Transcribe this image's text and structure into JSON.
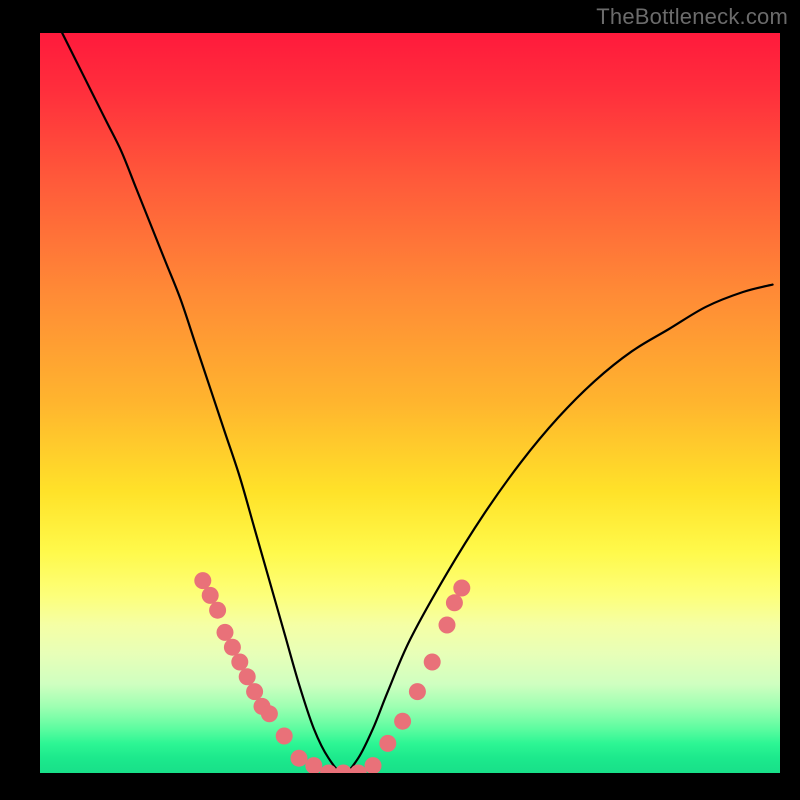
{
  "watermark": "TheBottleneck.com",
  "chart_data": {
    "type": "line",
    "title": "",
    "xlabel": "",
    "ylabel": "",
    "xlim": [
      0,
      100
    ],
    "ylim": [
      0,
      100
    ],
    "grid": false,
    "legend": false,
    "series": [
      {
        "name": "bottleneck-curve",
        "color": "#000000",
        "x": [
          3,
          5,
          7,
          9,
          11,
          13,
          15,
          17,
          19,
          21,
          23,
          25,
          27,
          29,
          31,
          33,
          35,
          37,
          39,
          41,
          43,
          45,
          47,
          50,
          55,
          60,
          65,
          70,
          75,
          80,
          85,
          90,
          95,
          99
        ],
        "values": [
          100,
          96,
          92,
          88,
          84,
          79,
          74,
          69,
          64,
          58,
          52,
          46,
          40,
          33,
          26,
          19,
          12,
          6,
          2,
          0,
          2,
          6,
          11,
          18,
          27,
          35,
          42,
          48,
          53,
          57,
          60,
          63,
          65,
          66
        ]
      }
    ],
    "highlight": {
      "name": "bottleneck-markers",
      "color": "#e97179",
      "points": [
        {
          "x": 22,
          "y": 26
        },
        {
          "x": 23,
          "y": 24
        },
        {
          "x": 24,
          "y": 22
        },
        {
          "x": 25,
          "y": 19
        },
        {
          "x": 26,
          "y": 17
        },
        {
          "x": 27,
          "y": 15
        },
        {
          "x": 28,
          "y": 13
        },
        {
          "x": 29,
          "y": 11
        },
        {
          "x": 30,
          "y": 9
        },
        {
          "x": 31,
          "y": 8
        },
        {
          "x": 33,
          "y": 5
        },
        {
          "x": 35,
          "y": 2
        },
        {
          "x": 37,
          "y": 1
        },
        {
          "x": 39,
          "y": 0
        },
        {
          "x": 41,
          "y": 0
        },
        {
          "x": 43,
          "y": 0
        },
        {
          "x": 45,
          "y": 1
        },
        {
          "x": 47,
          "y": 4
        },
        {
          "x": 49,
          "y": 7
        },
        {
          "x": 51,
          "y": 11
        },
        {
          "x": 53,
          "y": 15
        },
        {
          "x": 55,
          "y": 20
        },
        {
          "x": 56,
          "y": 23
        },
        {
          "x": 57,
          "y": 25
        }
      ]
    },
    "gradient_stops": [
      {
        "pos": 0,
        "color": "#ff1a3c"
      },
      {
        "pos": 50,
        "color": "#ffb52e"
      },
      {
        "pos": 75,
        "color": "#fdff7a"
      },
      {
        "pos": 100,
        "color": "#18e089"
      }
    ]
  }
}
